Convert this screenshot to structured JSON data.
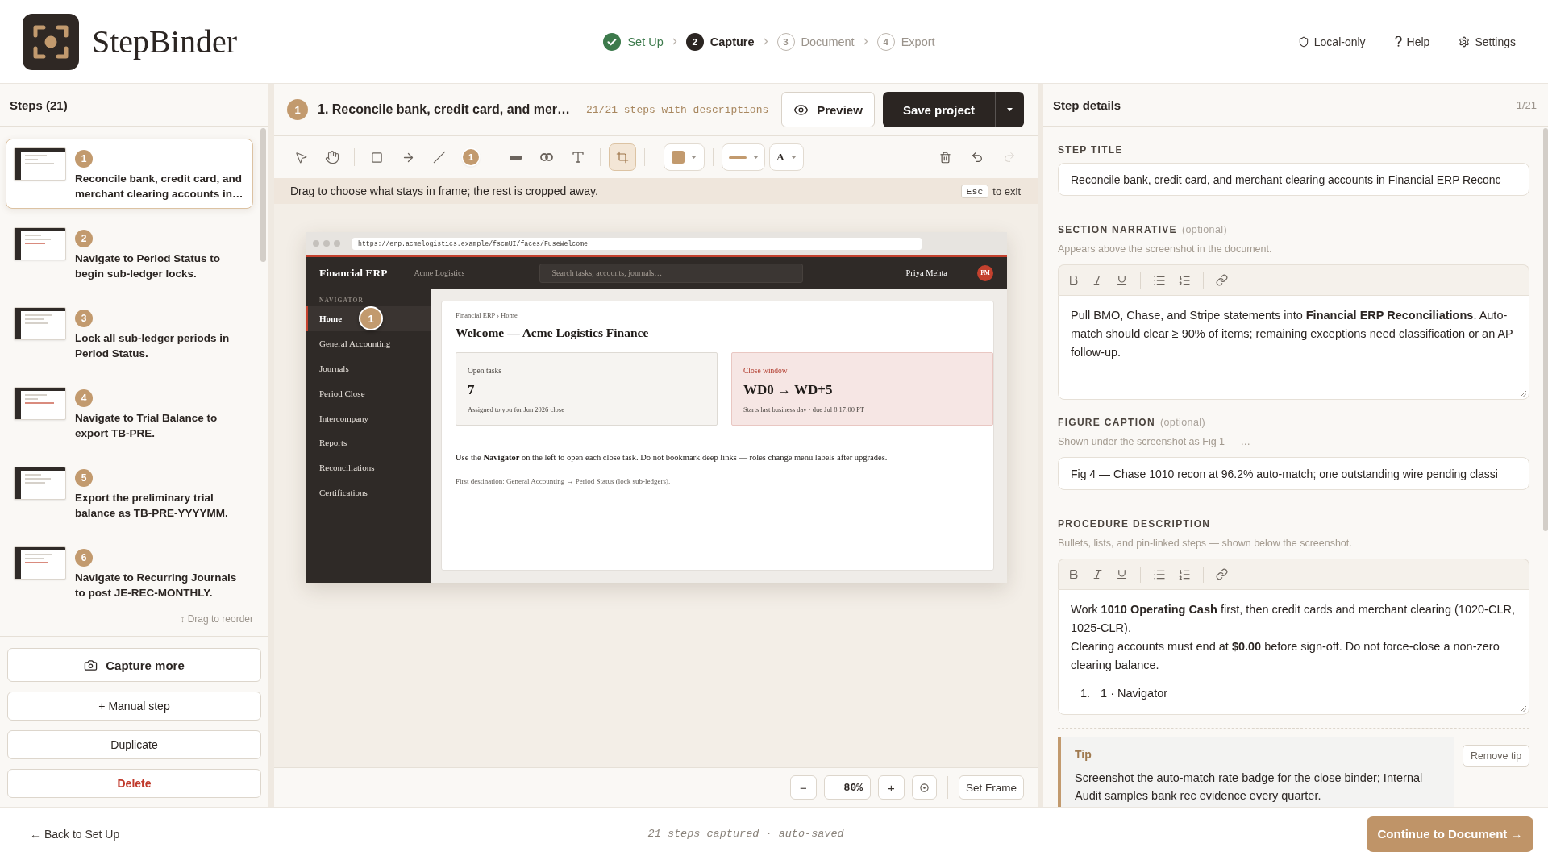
{
  "app": {
    "name": "StepBinder"
  },
  "stepper": [
    {
      "label": "Set Up",
      "completed": true,
      "selected": false
    },
    {
      "number": "2",
      "label": "Capture",
      "completed": false,
      "selected": true
    },
    {
      "number": "3",
      "label": "Document",
      "completed": false,
      "selected": false
    },
    {
      "number": "4",
      "label": "Export",
      "completed": false,
      "selected": false
    }
  ],
  "header_links": [
    {
      "label": "Local-only"
    },
    {
      "label": "Help"
    },
    {
      "label": "Settings"
    }
  ],
  "steps_panel": {
    "title": "Steps (21)",
    "steps": [
      {
        "number": "1",
        "title": "Reconcile bank, credit card, and merchant clearing accounts in…",
        "selected": true
      },
      {
        "number": "2",
        "title": "Navigate to Period Status to begin sub-ledger locks.",
        "selected": false
      },
      {
        "number": "3",
        "title": "Lock all sub-ledger periods in Period Status.",
        "selected": false
      },
      {
        "number": "4",
        "title": "Navigate to Trial Balance to export TB-PRE.",
        "selected": false
      },
      {
        "number": "5",
        "title": "Export the preliminary trial balance as TB-PRE-YYYYMM.",
        "selected": false
      },
      {
        "number": "6",
        "title": "Navigate to Recurring Journals to post JE-REC-MONTHLY.",
        "selected": false
      }
    ],
    "reorder_hint": "↕ Drag to reorder",
    "actions": [
      {
        "kind": "capture",
        "label": "Capture more"
      },
      {
        "kind": "plain",
        "label": "+ Manual step"
      },
      {
        "kind": "plain",
        "label": "Duplicate"
      },
      {
        "kind": "danger",
        "label": "Delete"
      }
    ]
  },
  "editor": {
    "badge": "1",
    "title": "1. Reconcile bank, credit card, and mer…",
    "description_count": "21/21 steps with descriptions",
    "preview": "Preview",
    "save": "Save project",
    "tool_groups": [
      [
        {
          "kind": "select",
          "selected": false
        },
        {
          "kind": "pan",
          "selected": false
        }
      ],
      [
        {
          "kind": "rectangle",
          "selected": false
        },
        {
          "kind": "arrow",
          "selected": false
        },
        {
          "kind": "line",
          "selected": false
        },
        {
          "kind": "pin",
          "label": "1",
          "selected": false
        }
      ],
      [
        {
          "kind": "highlight",
          "selected": false
        },
        {
          "kind": "blur",
          "selected": false
        },
        {
          "kind": "text",
          "selected": false
        }
      ],
      [
        {
          "kind": "crop",
          "selected": true
        }
      ]
    ],
    "style_controls": [
      {
        "kind": "color",
        "color": "#c29a6e"
      },
      {
        "kind": "stroke"
      },
      {
        "kind": "font",
        "label": "A"
      }
    ],
    "history": [
      {
        "kind": "delete",
        "disabled": false
      },
      {
        "kind": "undo",
        "disabled": false
      },
      {
        "kind": "redo",
        "disabled": true
      }
    ],
    "banner": {
      "text": "Drag to choose what stays in frame; the rest is cropped away.",
      "key": "Esc",
      "key_hint": "to exit"
    },
    "capture": {
      "url": "https://erp.acmelogistics.example/fscmUI/faces/FuseWelcome",
      "app_name": "Financial ERP",
      "org": "Acme Logistics",
      "search_placeholder": "Search tasks, accounts, journals…",
      "user": "Priya Mehta",
      "avatar": "PM",
      "nav_heading": "NAVIGATOR",
      "nav": [
        {
          "label": "Home",
          "selected": true
        },
        {
          "label": "General Accounting",
          "selected": false
        },
        {
          "label": "Journals",
          "selected": false
        },
        {
          "label": "Period Close",
          "selected": false
        },
        {
          "label": "Intercompany",
          "selected": false
        },
        {
          "label": "Reports",
          "selected": false
        },
        {
          "label": "Reconciliations",
          "selected": false
        },
        {
          "label": "Certifications",
          "selected": false
        }
      ],
      "breadcrumb": "Financial ERP › Home",
      "heading": "Welcome — Acme Logistics Finance",
      "cards": [
        {
          "kind": "neutral",
          "label": "Open tasks",
          "value": "7",
          "note": "Assigned to you for Jun 2026 close"
        },
        {
          "kind": "alert",
          "label": "Close window",
          "value": "WD0 → WD+5",
          "note": "Starts last business day · due Jul 8 17:00 PT"
        }
      ],
      "body": "Use the **Navigator** on the left to open each close task. Do not bookmark deep links — roles change menu labels after upgrades.",
      "footnote": "First destination: General Accounting → Period Status (lock sub-ledgers).",
      "pin": {
        "label": "1"
      }
    },
    "zoom": {
      "zoom_out": "−",
      "level": "80%",
      "zoom_in": "+",
      "set_frame": "Set Frame"
    }
  },
  "details": {
    "title": "Step details",
    "position": "1/21",
    "fields": [
      {
        "kind": "input",
        "label": "STEP TITLE",
        "value": "Reconcile bank, credit card, and merchant clearing accounts in Financial ERP Reconc"
      },
      {
        "kind": "rich",
        "label": "SECTION NARRATIVE",
        "optional": "(optional)",
        "hint": "Appears above the screenshot in the document.",
        "paragraphs": [
          "Pull BMO, Chase, and Stripe statements into **Financial ERP Reconciliations**. Auto-match should clear ≥ 90% of items; remaining exceptions need classification or an AP follow-up."
        ]
      },
      {
        "kind": "input",
        "label": "FIGURE CAPTION",
        "optional": "(optional)",
        "hint": "Shown under the screenshot as Fig 1 — …",
        "value": "Fig 4 — Chase 1010 recon at 96.2% auto-match; one outstanding wire pending classi"
      },
      {
        "kind": "rich",
        "label": "PROCEDURE DESCRIPTION",
        "hint": "Bullets, lists, and pin-linked steps — shown below the screenshot.",
        "paragraphs": [
          "Work **1010 Operating Cash** first, then credit cards and merchant clearing (1020-CLR, 1025-CLR).",
          "Clearing accounts must end at **$0.00** before sign-off. Do not force-close a non-zero clearing balance."
        ],
        "list": [
          {
            "number": "1.",
            "text": "1 · Navigator"
          }
        ]
      }
    ],
    "tip": {
      "label": "Tip",
      "text": "Screenshot the auto-match rate badge for the close binder; Internal Audit samples bank rec evidence every quarter.",
      "remove": "Remove tip"
    }
  },
  "footer": {
    "back": "← Back to Set Up",
    "status": "21 steps captured · auto-saved",
    "continue": "Continue to Document →"
  }
}
